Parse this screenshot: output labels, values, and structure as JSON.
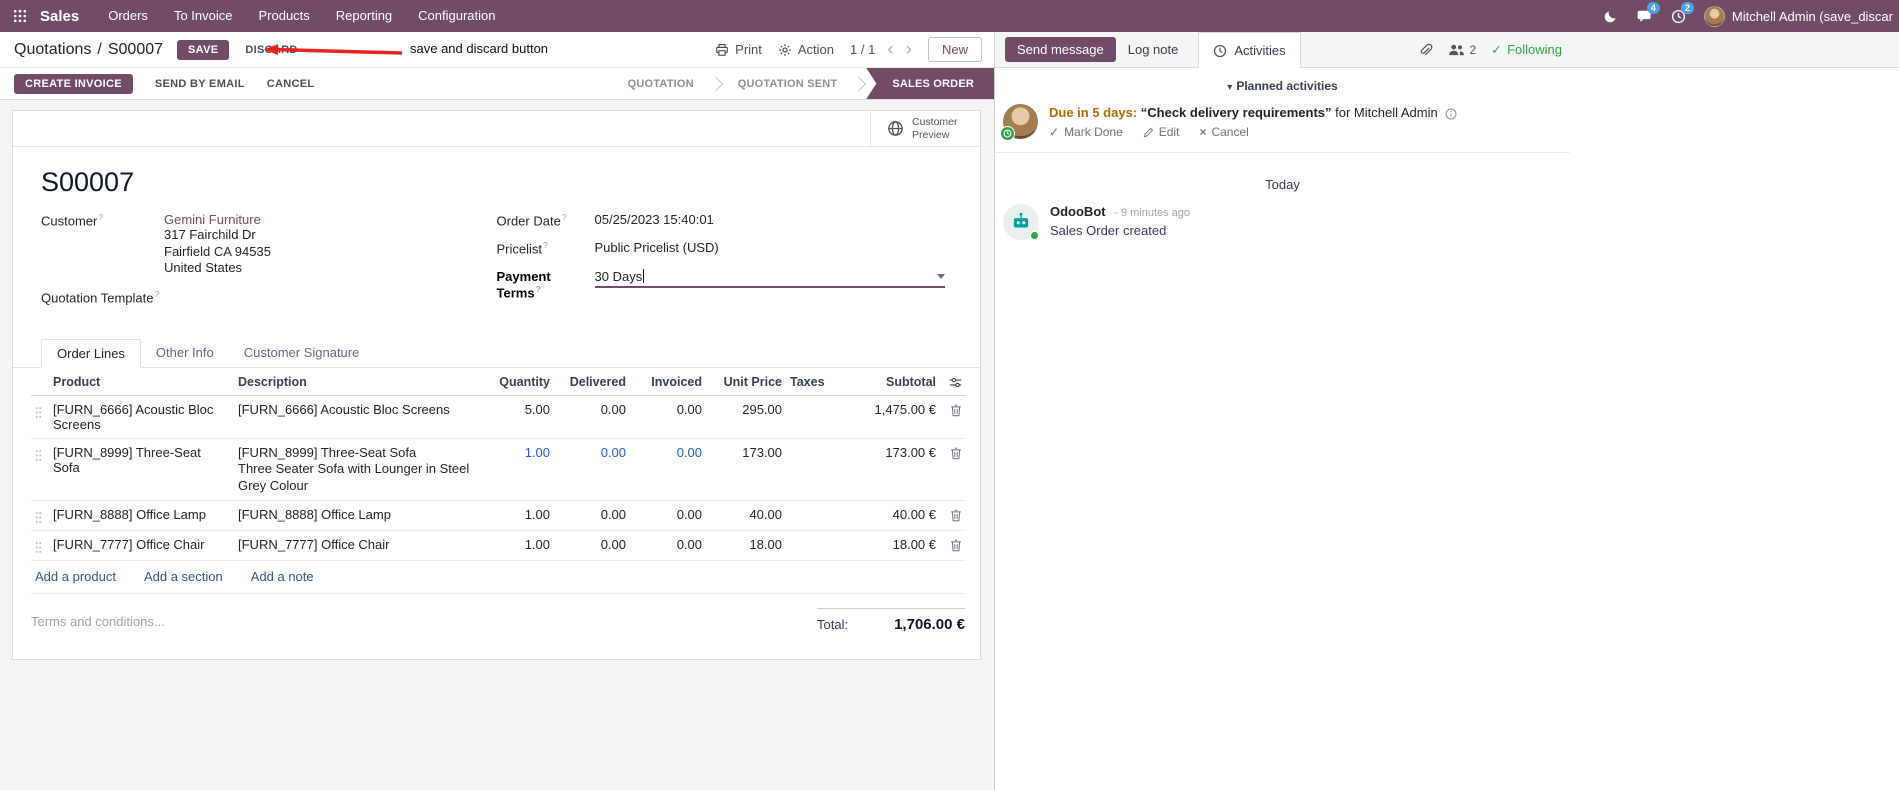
{
  "topbar": {
    "app_name": "Sales",
    "menus": [
      "Orders",
      "To Invoice",
      "Products",
      "Reporting",
      "Configuration"
    ],
    "messages_badge": "4",
    "activities_badge": "2",
    "user_name": "Mitchell Admin (save_discar"
  },
  "control_panel": {
    "breadcrumb_parent": "Quotations",
    "breadcrumb_sep": "/",
    "breadcrumb_current": "S00007",
    "save_label": "SAVE",
    "discard_label": "DISCARD",
    "annotation_text": "save and discard button",
    "print_label": "Print",
    "action_label": "Action",
    "pager_value": "1 / 1",
    "new_label": "New"
  },
  "statusbar": {
    "create_invoice": "CREATE INVOICE",
    "send_by_email": "SEND BY EMAIL",
    "cancel": "CANCEL",
    "states": [
      {
        "label": "QUOTATION",
        "active": false
      },
      {
        "label": "QUOTATION SENT",
        "active": false
      },
      {
        "label": "SALES ORDER",
        "active": true
      }
    ]
  },
  "sheet": {
    "customer_preview_label": "Customer Preview",
    "title": "S00007",
    "help_marker": "?",
    "customer": {
      "label": "Customer",
      "name": "Gemini Furniture",
      "address_line1": "317 Fairchild Dr",
      "address_line2": "Fairfield CA 94535",
      "address_line3": "United States"
    },
    "quotation_template_label": "Quotation Template",
    "order_date": {
      "label": "Order Date",
      "value": "05/25/2023 15:40:01"
    },
    "pricelist": {
      "label": "Pricelist",
      "value": "Public Pricelist (USD)"
    },
    "payment_terms": {
      "label": "Payment Terms",
      "value": "30 Days"
    }
  },
  "tabs": {
    "order_lines": "Order Lines",
    "other_info": "Other Info",
    "customer_signature": "Customer Signature"
  },
  "order_lines": {
    "columns": {
      "product": "Product",
      "description": "Description",
      "quantity": "Quantity",
      "delivered": "Delivered",
      "invoiced": "Invoiced",
      "unit_price": "Unit Price",
      "taxes": "Taxes",
      "subtotal": "Subtotal"
    },
    "rows": [
      {
        "product": "[FURN_6666] Acoustic Bloc Screens",
        "description": "[FURN_6666] Acoustic Bloc Screens",
        "description2": "",
        "quantity": "5.00",
        "delivered": "0.00",
        "invoiced": "0.00",
        "unit_price": "295.00",
        "taxes": "",
        "subtotal": "1,475.00 €"
      },
      {
        "product": "[FURN_8999] Three-Seat Sofa",
        "description": "[FURN_8999] Three-Seat Sofa",
        "description2": "Three Seater Sofa with Lounger in Steel Grey Colour",
        "quantity": "1.00",
        "delivered": "0.00",
        "invoiced": "0.00",
        "unit_price": "173.00",
        "taxes": "",
        "subtotal": "173.00 €"
      },
      {
        "product": "[FURN_8888] Office Lamp",
        "description": "[FURN_8888] Office Lamp",
        "description2": "",
        "quantity": "1.00",
        "delivered": "0.00",
        "invoiced": "0.00",
        "unit_price": "40.00",
        "taxes": "",
        "subtotal": "40.00 €"
      },
      {
        "product": "[FURN_7777] Office Chair",
        "description": "[FURN_7777] Office Chair",
        "description2": "",
        "quantity": "1.00",
        "delivered": "0.00",
        "invoiced": "0.00",
        "unit_price": "18.00",
        "taxes": "",
        "subtotal": "18.00 €"
      }
    ],
    "add_product": "Add a product",
    "add_section": "Add a section",
    "add_note": "Add a note",
    "terms_placeholder": "Terms and conditions...",
    "total_label": "Total:",
    "total_value": "1,706.00 €"
  },
  "chatter": {
    "send_message": "Send message",
    "log_note": "Log note",
    "activities": "Activities",
    "followers_count": "2",
    "following": "Following",
    "planned_header": "Planned activities",
    "activity": {
      "due": "Due in 5 days:",
      "summary": "“Check delivery requirements”",
      "assignee": "for Mitchell Admin",
      "mark_done": "Mark Done",
      "edit": "Edit",
      "cancel": "Cancel"
    },
    "today": "Today",
    "message": {
      "author": "OdooBot",
      "time": "- 9 minutes ago",
      "body": "Sales Order created"
    }
  },
  "colors": {
    "brand": "#714B67",
    "topbar_badge": "#45A5E6",
    "edited_value_blue": "#2160C4",
    "activity_due": "#AD7102",
    "following_green": "#28A745",
    "annotation_red": "#E8251E"
  }
}
